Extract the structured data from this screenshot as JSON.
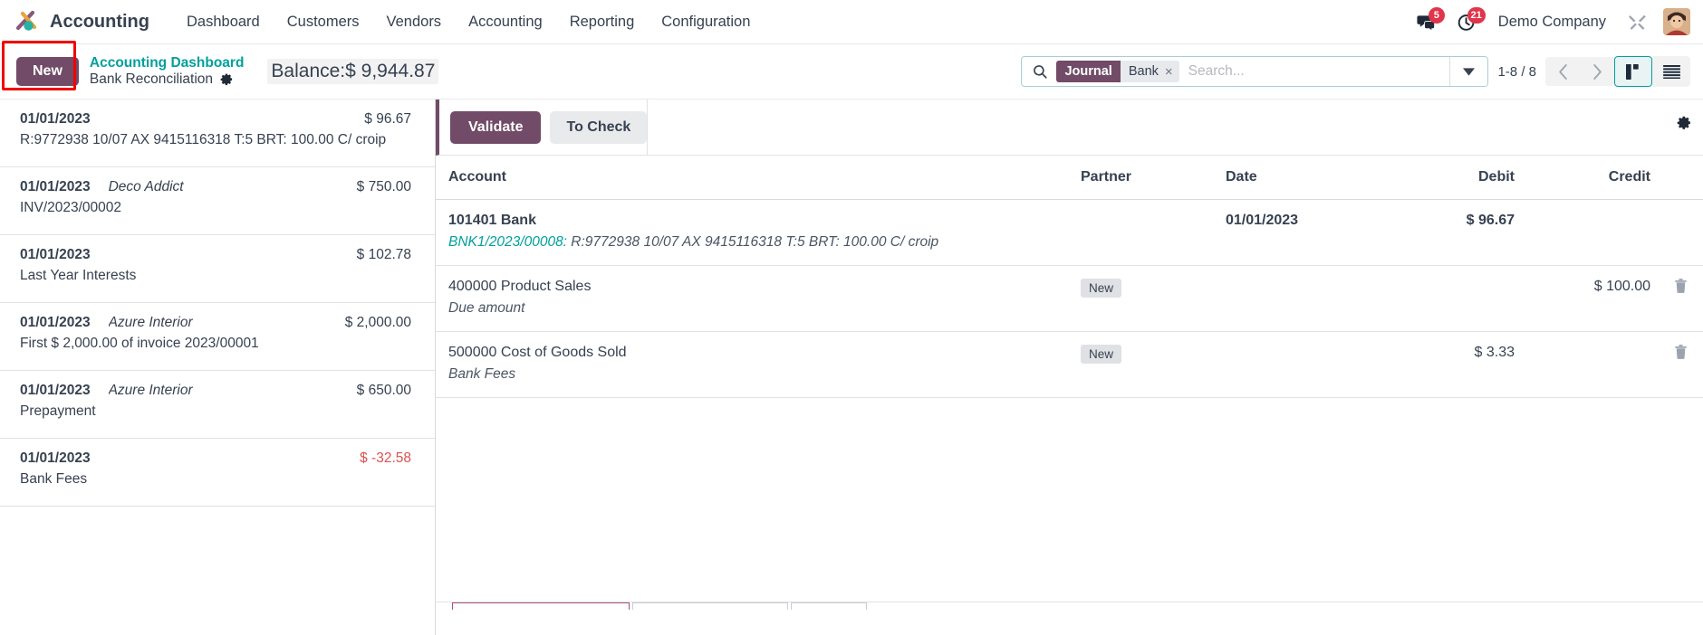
{
  "navbar": {
    "app_name": "Accounting",
    "logo_icon": "odoo-logo-icon",
    "menu_items": [
      {
        "label": "Dashboard"
      },
      {
        "label": "Customers"
      },
      {
        "label": "Vendors"
      },
      {
        "label": "Accounting"
      },
      {
        "label": "Reporting"
      },
      {
        "label": "Configuration"
      }
    ],
    "messages": {
      "icon": "chat-bubble-icon",
      "count": "5"
    },
    "activities": {
      "icon": "clock-icon",
      "count": "21"
    },
    "company": "Demo Company",
    "tools_icon": "wrench-screwdriver-icon",
    "avatar_icon": "user-avatar"
  },
  "control_panel": {
    "new_button": "New",
    "breadcrumb_parent": "Accounting Dashboard",
    "breadcrumb_current": "Bank Reconciliation",
    "settings_icon": "gear-icon",
    "balance_label": "Balance:",
    "balance_value": "$ 9,944.87",
    "search": {
      "icon": "search-icon",
      "facet_label": "Journal",
      "facet_value": "Bank",
      "facet_remove_icon": "close-icon",
      "placeholder": "Search...",
      "value": "",
      "dropdown_icon": "chevron-down-icon"
    },
    "pager": {
      "count": "1-8 / 8",
      "prev_icon": "chevron-left-icon",
      "next_icon": "chevron-right-icon"
    },
    "views": [
      {
        "name": "kanban",
        "icon": "kanban-view-icon",
        "active": true
      },
      {
        "name": "list",
        "icon": "list-view-icon",
        "active": false
      }
    ]
  },
  "statement_list": [
    {
      "date": "01/01/2023",
      "partner": "",
      "amount": "$ 96.67",
      "negative": false,
      "label": "R:9772938 10/07 AX 9415116318 T:5 BRT: 100.00 C/ croip",
      "selected": true
    },
    {
      "date": "01/01/2023",
      "partner": "Deco Addict",
      "amount": "$ 750.00",
      "negative": false,
      "label": "INV/2023/00002",
      "selected": false
    },
    {
      "date": "01/01/2023",
      "partner": "",
      "amount": "$ 102.78",
      "negative": false,
      "label": "Last Year Interests",
      "selected": false
    },
    {
      "date": "01/01/2023",
      "partner": "Azure Interior",
      "amount": "$ 2,000.00",
      "negative": false,
      "label": "First $ 2,000.00 of invoice 2023/00001",
      "selected": false
    },
    {
      "date": "01/01/2023",
      "partner": "Azure Interior",
      "amount": "$ 650.00",
      "negative": false,
      "label": "Prepayment",
      "selected": false
    },
    {
      "date": "01/01/2023",
      "partner": "",
      "amount": "$ -32.58",
      "negative": true,
      "label": "Bank Fees",
      "selected": false
    }
  ],
  "reconciliation": {
    "validate_button": "Validate",
    "to_check_button": "To Check",
    "settings_icon": "gear-icon",
    "columns": {
      "account": "Account",
      "partner": "Partner",
      "date": "Date",
      "debit": "Debit",
      "credit": "Credit"
    },
    "lines": [
      {
        "account": "101401 Bank",
        "account_bold": true,
        "ref": "BNK1/2023/00008:",
        "sub": " R:9772938 10/07 AX 9415116318 T:5 BRT: 100.00 C/ croip",
        "partner": "",
        "date": "01/01/2023",
        "date_bold": true,
        "debit": "$ 96.67",
        "debit_bold": true,
        "credit": "",
        "trash": false
      },
      {
        "account": "400000 Product Sales",
        "account_bold": false,
        "ref": "",
        "sub": "Due amount",
        "partner": "New",
        "date": "",
        "date_bold": false,
        "debit": "",
        "debit_bold": false,
        "credit": "$ 100.00",
        "trash": true,
        "trash_icon": "trash-icon"
      },
      {
        "account": "500000 Cost of Goods Sold",
        "account_bold": false,
        "ref": "",
        "sub": "Bank Fees",
        "partner": "New",
        "date": "",
        "date_bold": false,
        "debit": "$ 3.33",
        "debit_bold": false,
        "credit": "",
        "trash": true,
        "trash_icon": "trash-icon"
      }
    ]
  },
  "colors": {
    "brand_purple": "#714b67",
    "teal": "#00a09d",
    "badge_red": "#e0354a",
    "highlight_red": "#f10303",
    "negative_red": "#d9534f"
  }
}
